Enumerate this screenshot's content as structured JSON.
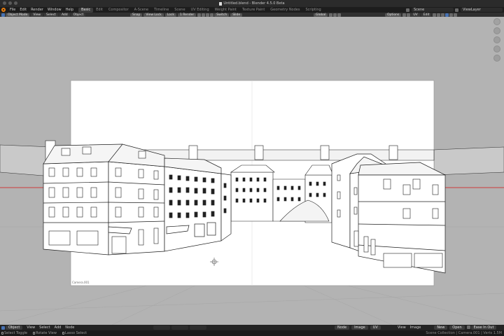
{
  "window": {
    "title": "Untitled.blend - Blender 4.5.0 Beta"
  },
  "menu": {
    "items": [
      "File",
      "Edit",
      "Render",
      "Window",
      "Help"
    ],
    "workspaces": [
      {
        "label": "Basic",
        "active": true
      },
      {
        "label": "Edit",
        "active": false
      },
      {
        "label": "Compositor",
        "active": false
      },
      {
        "label": "A-Scene",
        "active": false
      },
      {
        "label": "Timeline",
        "active": false
      },
      {
        "label": "Scene",
        "active": false
      },
      {
        "label": "UV Editing",
        "active": false
      },
      {
        "label": "Weight Paint",
        "active": false
      },
      {
        "label": "Texture Paint",
        "active": false
      },
      {
        "label": "Geometry Nodes",
        "active": false
      },
      {
        "label": "Scripting",
        "active": false
      }
    ],
    "scene_label": "Scene",
    "view_layer_label": "ViewLayer"
  },
  "viewport_header": {
    "mode": "Object Mode",
    "menus": [
      "View",
      "Select",
      "Add",
      "Object"
    ],
    "center_buttons": [
      "Snap",
      "View Lock",
      "Lock",
      "1 Render",
      "Switch",
      "Slide"
    ],
    "orientation": "Global",
    "options_label": "Options",
    "overlay_labels": [
      "UV",
      "Edit"
    ]
  },
  "camera_label": "Camera.001",
  "bottom_bar": {
    "mode": "Object",
    "menus": [
      "View",
      "Select",
      "Add",
      "Node"
    ],
    "right_items": [
      "Node",
      "Image",
      "UV"
    ],
    "view_items": [
      "View",
      "Image"
    ],
    "new_label": "New",
    "open_label": "Open",
    "slot_label": "Ease In Out"
  },
  "status_bar": {
    "hints": [
      "Select Toggle",
      "Rotate View",
      "Lasso Select"
    ],
    "right": "Scene Collection | Camera.001 | Verts 1.5M"
  },
  "colors": {
    "horizon_line": "#cc3b3b",
    "blender_orange": "#e87d0d",
    "active_blue": "#4772b3"
  }
}
